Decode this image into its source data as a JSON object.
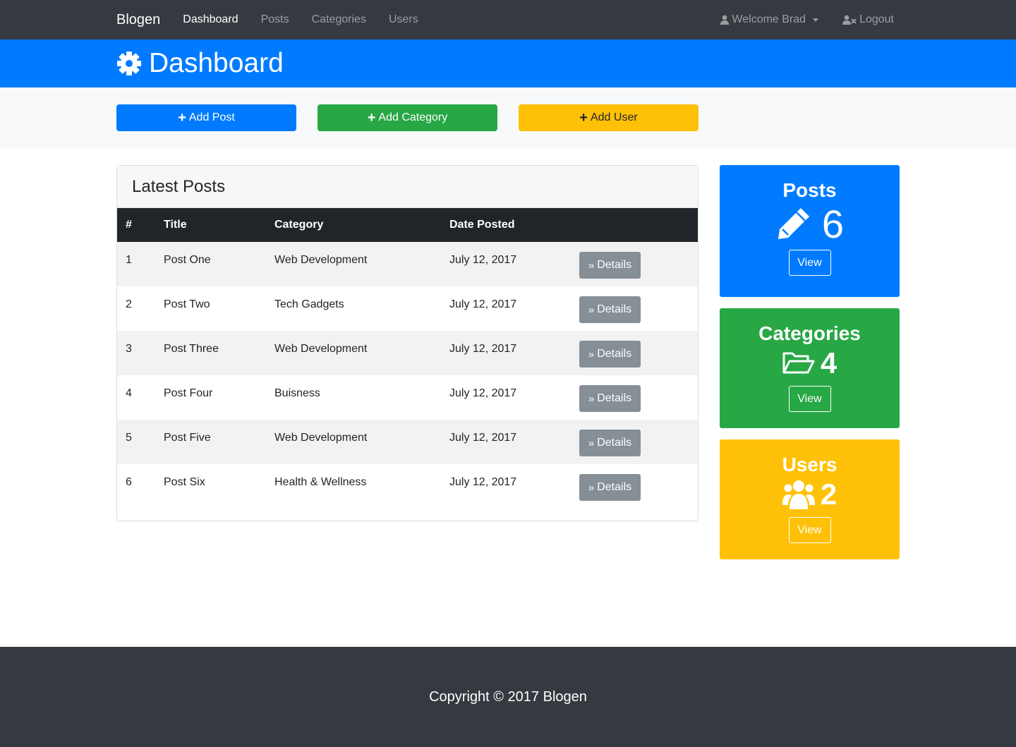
{
  "navbar": {
    "brand": "Blogen",
    "links": [
      "Dashboard",
      "Posts",
      "Categories",
      "Users"
    ],
    "welcome": "Welcome Brad",
    "logout": "Logout"
  },
  "header": {
    "title": "Dashboard"
  },
  "actions": {
    "add_post": "Add Post",
    "add_category": "Add Category",
    "add_user": "Add User"
  },
  "latest_posts": {
    "title": "Latest Posts",
    "columns": [
      "#",
      "Title",
      "Category",
      "Date Posted"
    ],
    "details_label": "Details",
    "rows": [
      {
        "num": "1",
        "title": "Post One",
        "category": "Web Development",
        "date": "July 12, 2017"
      },
      {
        "num": "2",
        "title": "Post Two",
        "category": "Tech Gadgets",
        "date": "July 12, 2017"
      },
      {
        "num": "3",
        "title": "Post Three",
        "category": "Web Development",
        "date": "July 12, 2017"
      },
      {
        "num": "4",
        "title": "Post Four",
        "category": "Buisness",
        "date": "July 12, 2017"
      },
      {
        "num": "5",
        "title": "Post Five",
        "category": "Web Development",
        "date": "July 12, 2017"
      },
      {
        "num": "6",
        "title": "Post Six",
        "category": "Health & Wellness",
        "date": "July 12, 2017"
      }
    ]
  },
  "stats": {
    "posts": {
      "label": "Posts",
      "count": "6",
      "view": "View"
    },
    "categories": {
      "label": "Categories",
      "count": "4",
      "view": "View"
    },
    "users": {
      "label": "Users",
      "count": "2",
      "view": "View"
    }
  },
  "footer": {
    "copyright": "Copyright © 2017 Blogen"
  },
  "colors": {
    "primary": "#007bff",
    "success": "#28a745",
    "warning": "#ffc107",
    "dark": "#343a40",
    "secondary": "#868e96"
  },
  "icons": [
    "user-icon",
    "user-times-icon",
    "cog-icon",
    "plus-icon",
    "angle-double-right-icon",
    "pencil-icon",
    "folder-open-icon",
    "users-icon"
  ]
}
